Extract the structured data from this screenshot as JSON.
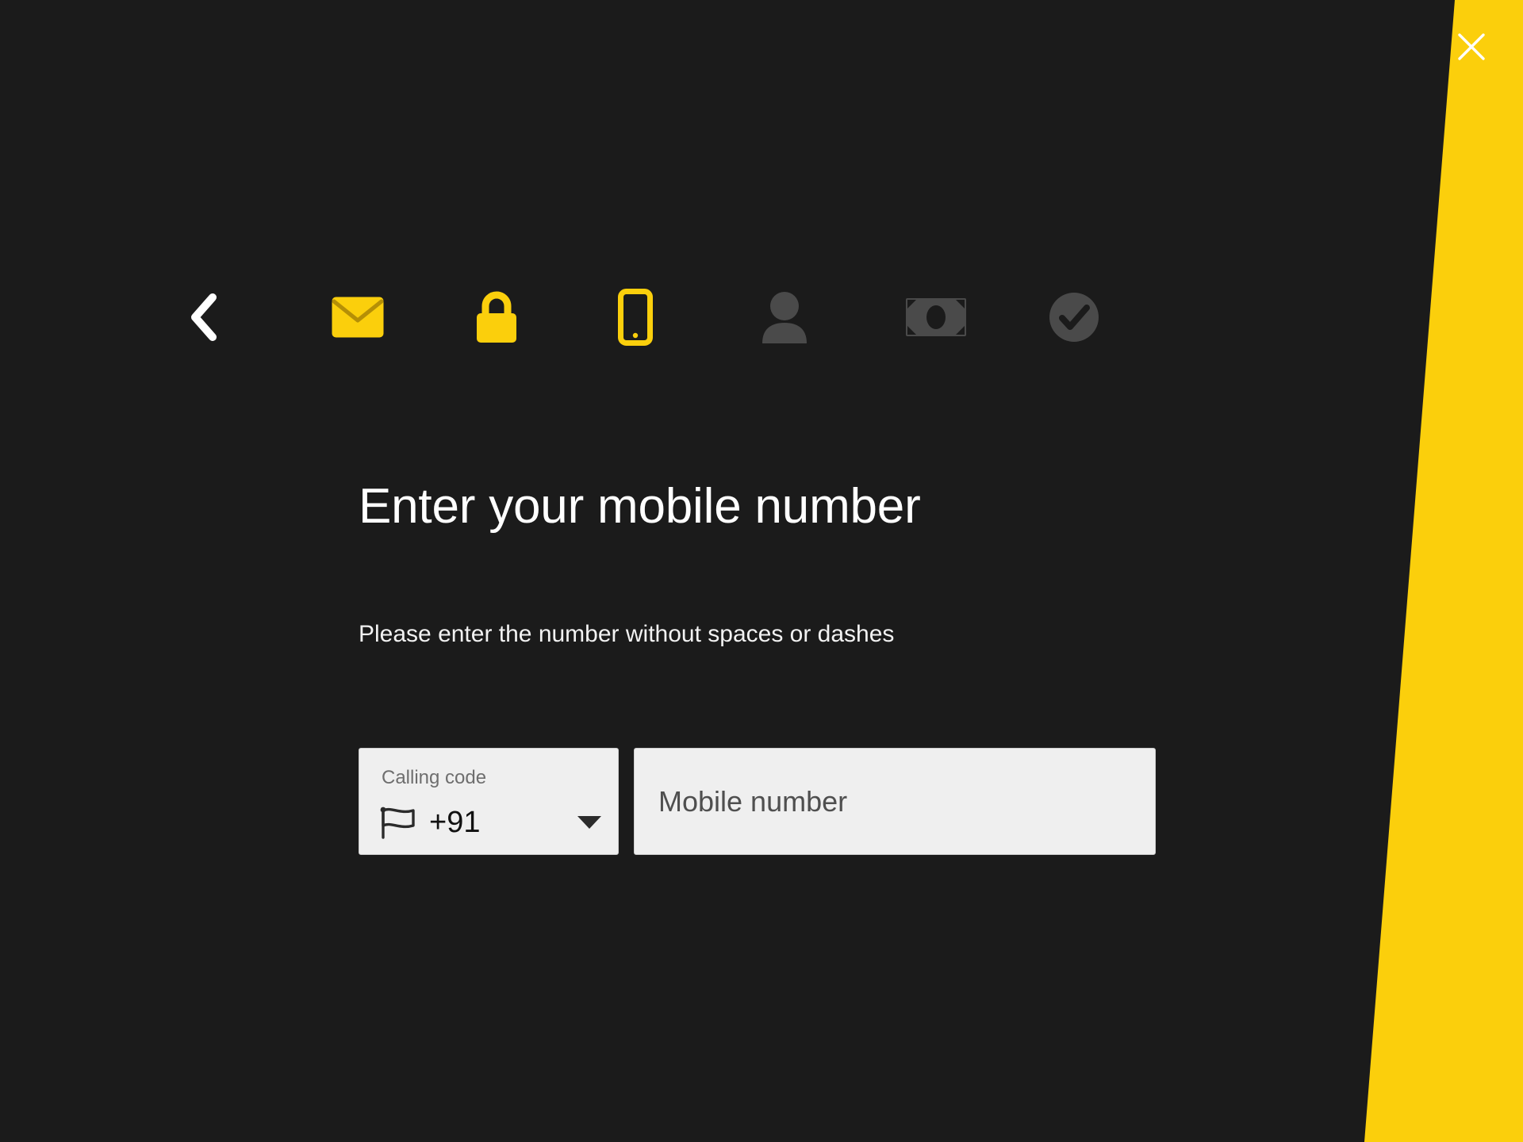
{
  "theme": {
    "background": "#1b1b1b",
    "accent_yellow": "#fbcf0c",
    "field_background": "#efefef",
    "text_primary": "#ffffff",
    "icon_inactive": "#4a4a4a"
  },
  "window": {
    "close_label": "close-icon"
  },
  "steps": {
    "back_label": "back-chevron-icon",
    "items": [
      {
        "name": "email-step-icon",
        "icon": "envelope",
        "state": "complete",
        "color": "#fbcf0c"
      },
      {
        "name": "password-step-icon",
        "icon": "lock",
        "state": "complete",
        "color": "#fbcf0c"
      },
      {
        "name": "mobile-step-icon",
        "icon": "phone",
        "state": "current",
        "color": "#fbcf0c"
      },
      {
        "name": "personal-details-step-icon",
        "icon": "person",
        "state": "upcoming",
        "color": "#4a4a4a"
      },
      {
        "name": "funding-step-icon",
        "icon": "banknote",
        "state": "upcoming",
        "color": "#4a4a4a"
      },
      {
        "name": "confirmation-step-icon",
        "icon": "check-circle",
        "state": "upcoming",
        "color": "#4a4a4a"
      }
    ]
  },
  "main": {
    "title": "Enter your mobile number",
    "subtitle": "Please enter the number without spaces or dashes"
  },
  "form": {
    "calling_code": {
      "label": "Calling code",
      "value": "+91",
      "flag_icon": "flag-icon",
      "caret_icon": "chevron-down-icon"
    },
    "mobile_number": {
      "placeholder": "Mobile number",
      "value": ""
    }
  }
}
